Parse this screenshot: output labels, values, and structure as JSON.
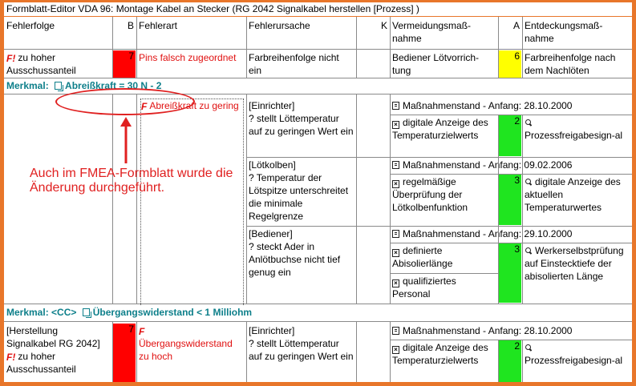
{
  "window": {
    "title": "Formblatt-Editor VDA 96: Montage Kabel an Stecker (RG 2042 Signalkabel herstellen [Prozess] )"
  },
  "header": {
    "fehlerfolge": "Fehlerfolge",
    "b": "B",
    "fehlerart": "Fehlerart",
    "fehlerursache": "Fehlerursache",
    "k": "K",
    "vermeidung": "Vermeidungsmaß-\nnahme",
    "a": "A",
    "entdeckung": "Entdeckungsmaß-\nnahme"
  },
  "row1": {
    "fehlerfolge": "zu hoher Ausschussanteil",
    "b": "7",
    "fehlerart": "Pins falsch zugeordnet",
    "fehlerursache": "Farbreihenfolge nicht ein",
    "vermeidung": "Bediener Lötvorrich-tung",
    "a": "6",
    "entdeckung": "Farbreihenfolge nach dem Nachlöten"
  },
  "merkmal1": {
    "label": "Merkmal:",
    "text": "Abreißkraft = 30 N - 2"
  },
  "block1": {
    "fehlerart": "Abreißkraft zu gering",
    "causes": [
      {
        "text": "[Einrichter]\n? stellt Löttemperatur auf zu geringen Wert ein",
        "stand": "Maßnahmenstand - Anfang: 28.10.2000",
        "vermeidung": "digitale Anzeige des Temperaturzielwerts",
        "a": "2",
        "entdeckung": "Prozessfreigabesign-al"
      },
      {
        "text": "[Lötkolben]\n? Temperatur der Lötspitze unterschreitet die minimale Regelgrenze",
        "stand": "Maßnahmenstand - Anfang: 09.02.2006",
        "vermeidung": "regelmäßige Überprüfung der Lötkolbenfunktion",
        "a": "3",
        "entdeckung": "digitale Anzeige des aktuellen Temperaturwertes"
      },
      {
        "text": "[Bediener]\n? steckt Ader in Anlötbuchse nicht tief genug ein",
        "stand": "Maßnahmenstand - Anfang: 29.10.2000",
        "vermeidung": "definierte Abisolierlänge",
        "vermeidung2": "qualifiziertes Personal",
        "a": "3",
        "entdeckung": "Werkerselbstprüfung auf Einstecktiefe der abisolierten Länge"
      }
    ]
  },
  "annotation": "Auch im FMEA-Formblatt wurde die Änderung durchgeführt.",
  "merkmal2": {
    "label": "Merkmal:",
    "cc": "<CC>",
    "text": "Übergangswiderstand < 1 Milliohm"
  },
  "row3": {
    "fehlerfolge_head": "[Herstellung Signalkabel RG 2042]",
    "fehlerfolge": "zu hoher Ausschussanteil",
    "b": "7",
    "fehlerart": "Übergangswiderstand zu hoch",
    "fehlerursache": "[Einrichter]\n? stellt Löttemperatur auf zu geringen Wert ein",
    "stand": "Maßnahmenstand - Anfang: 28.10.2000",
    "vermeidung": "digitale Anzeige des Temperaturzielwerts",
    "a": "2",
    "entdeckung": "Prozessfreigabesign-al"
  },
  "colors": {
    "frame": "#e8762a",
    "red": "#ff0000",
    "yellow": "#ffff00",
    "green": "#1fe51f",
    "merkmal": "#0d7f8a"
  }
}
